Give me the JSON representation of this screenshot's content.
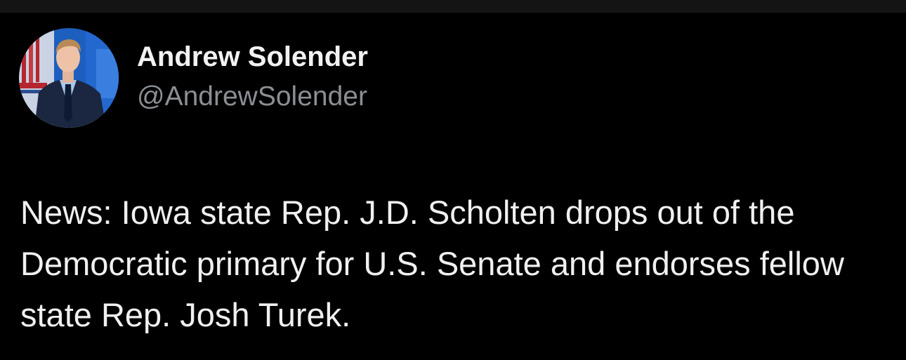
{
  "colors": {
    "background": "#000000",
    "top_strip": "#141414",
    "name_text": "#f2f2f2",
    "handle_text": "#8b8f94",
    "body_text": "#f0f0f0"
  },
  "author": {
    "display_name": "Andrew Solender",
    "handle": "@AndrewSolender",
    "avatar_icon": "profile-photo"
  },
  "tweet": {
    "text": "News: Iowa state Rep. J.D. Scholten drops out of the Democratic primary for U.S. Senate and endorses fellow state Rep. Josh Turek."
  }
}
